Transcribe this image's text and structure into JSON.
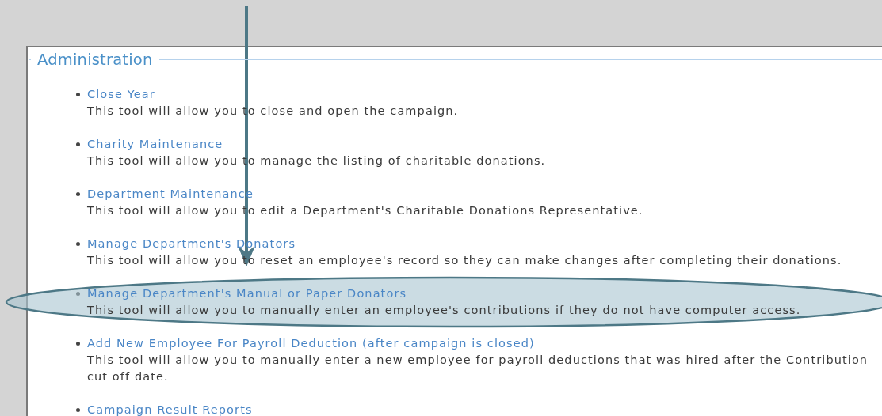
{
  "section": {
    "title": "Administration"
  },
  "tools": [
    {
      "name": "Close Year",
      "description": "This tool will allow you to close and open the campaign.",
      "highlighted": false
    },
    {
      "name": "Charity Maintenance",
      "description": "This tool will allow you to manage the listing of charitable donations.",
      "highlighted": false
    },
    {
      "name": "Department Maintenance",
      "description": "This tool will allow you to edit a Department's Charitable Donations Representative.",
      "highlighted": false
    },
    {
      "name": "Manage Department's Donators",
      "description": "This tool will allow you to reset an employee's record so they can make changes after completing their donations.",
      "highlighted": false
    },
    {
      "name": "Manage Department's Manual or Paper Donators",
      "description": "This tool will allow you to manually enter an employee's contributions if they do not have computer access.",
      "highlighted": true
    },
    {
      "name": "Add New Employee For Payroll Deduction (after campaign is closed)",
      "description": "This tool will allow you to manually enter a new employee for payroll deductions that was hired after the Contribution cut off date.",
      "highlighted": false
    },
    {
      "name": "Campaign Result Reports",
      "highlighted": false
    }
  ]
}
